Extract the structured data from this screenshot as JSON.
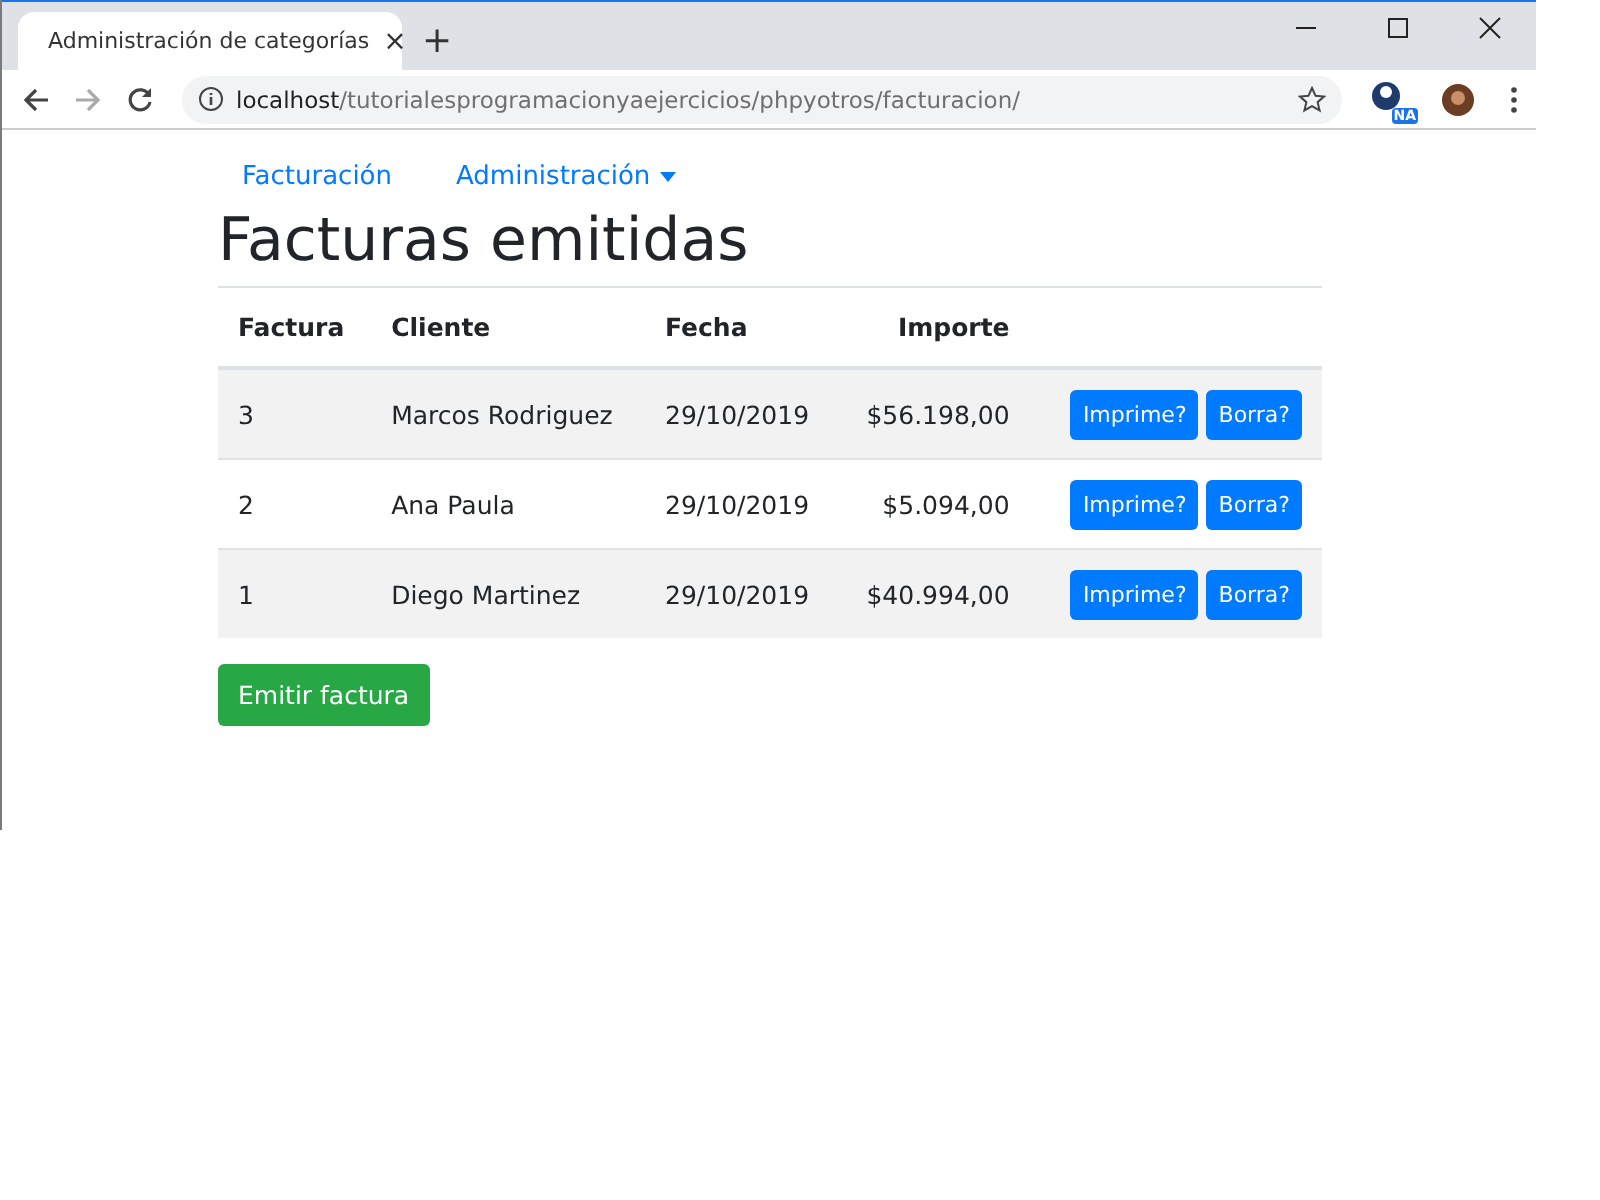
{
  "browser": {
    "tab": {
      "title": "Administración de categorías",
      "close": "×"
    },
    "new_tab": "+",
    "address": {
      "host": "localhost",
      "path": "/tutorialesprogramacionyaejercicios/phpyotros/facturacion/"
    },
    "extension_badge": "NA"
  },
  "nav": [
    {
      "label": "Facturación",
      "kind": "link"
    },
    {
      "label": "Administración",
      "kind": "dropdown"
    }
  ],
  "heading": "Facturas emitidas",
  "table": {
    "columns": [
      "Factura",
      "Cliente",
      "Fecha",
      "Importe"
    ],
    "rows": [
      {
        "cells": [
          "3",
          "Marcos Rodriguez",
          "29/10/2019",
          "$56.198,00"
        ],
        "actions": [
          "Imprime?",
          "Borra?"
        ]
      },
      {
        "cells": [
          "2",
          "Ana Paula",
          "29/10/2019",
          "$5.094,00"
        ],
        "actions": [
          "Imprime?",
          "Borra?"
        ]
      },
      {
        "cells": [
          "1",
          "Diego Martinez",
          "29/10/2019",
          "$40.994,00"
        ],
        "actions": [
          "Imprime?",
          "Borra?"
        ]
      }
    ]
  },
  "primary_button": "Emitir factura"
}
